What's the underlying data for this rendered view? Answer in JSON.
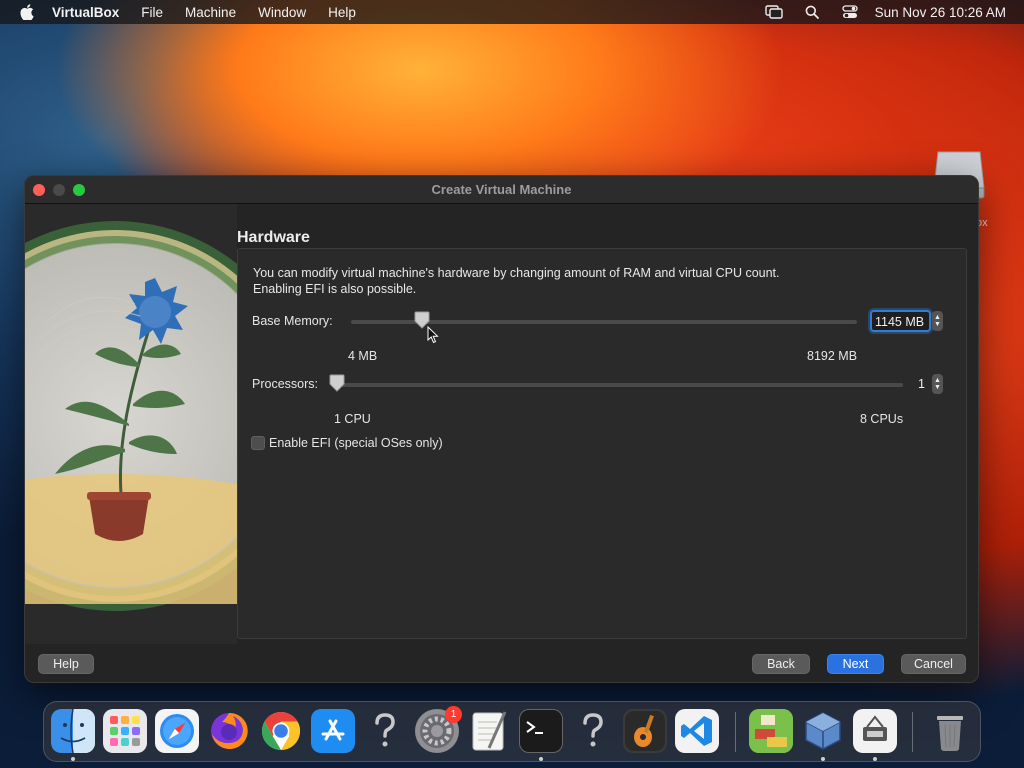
{
  "menubar": {
    "app_name": "VirtualBox",
    "items": [
      "File",
      "Machine",
      "Window",
      "Help"
    ],
    "clock": "Sun Nov 26  10:26 AM",
    "icons": [
      "screen-mirroring-icon",
      "search-icon",
      "control-center-icon"
    ]
  },
  "desktop": {
    "drive_label": "ox"
  },
  "window": {
    "title": "Create Virtual Machine",
    "section_title": "Hardware",
    "description_line1": "You can modify virtual machine's hardware by changing amount of RAM and virtual CPU count.",
    "description_line2": "Enabling EFI is also possible.",
    "memory": {
      "label": "Base Memory:",
      "value_text": "1145 MB",
      "value": 1145,
      "min": 4,
      "max": 8192,
      "min_label": "4 MB",
      "max_label": "8192 MB"
    },
    "processors": {
      "label": "Processors:",
      "value_text": "1",
      "value": 1,
      "min": 1,
      "max": 8,
      "min_label": "1 CPU",
      "max_label": "8 CPUs"
    },
    "efi": {
      "label": "Enable EFI (special OSes only)",
      "checked": false
    },
    "buttons": {
      "help": "Help",
      "back": "Back",
      "next": "Next",
      "cancel": "Cancel"
    }
  },
  "dock": {
    "mail_badge": "1",
    "items": [
      "finder-icon",
      "launchpad-icon",
      "safari-icon",
      "firefox-icon",
      "chrome-icon",
      "app-store-icon",
      "unknown-app-icon",
      "system-preferences-icon",
      "textedit-icon",
      "terminal-icon",
      "unknown-app-icon",
      "garageband-icon",
      "vscode-icon",
      "minecraft-icon",
      "virtualbox-icon",
      "utility-icon",
      "trash-icon"
    ]
  },
  "colors": {
    "accent": "#2a72e0",
    "close": "#ff5f57",
    "maximize": "#28c840",
    "badge": "#ff3b30"
  }
}
